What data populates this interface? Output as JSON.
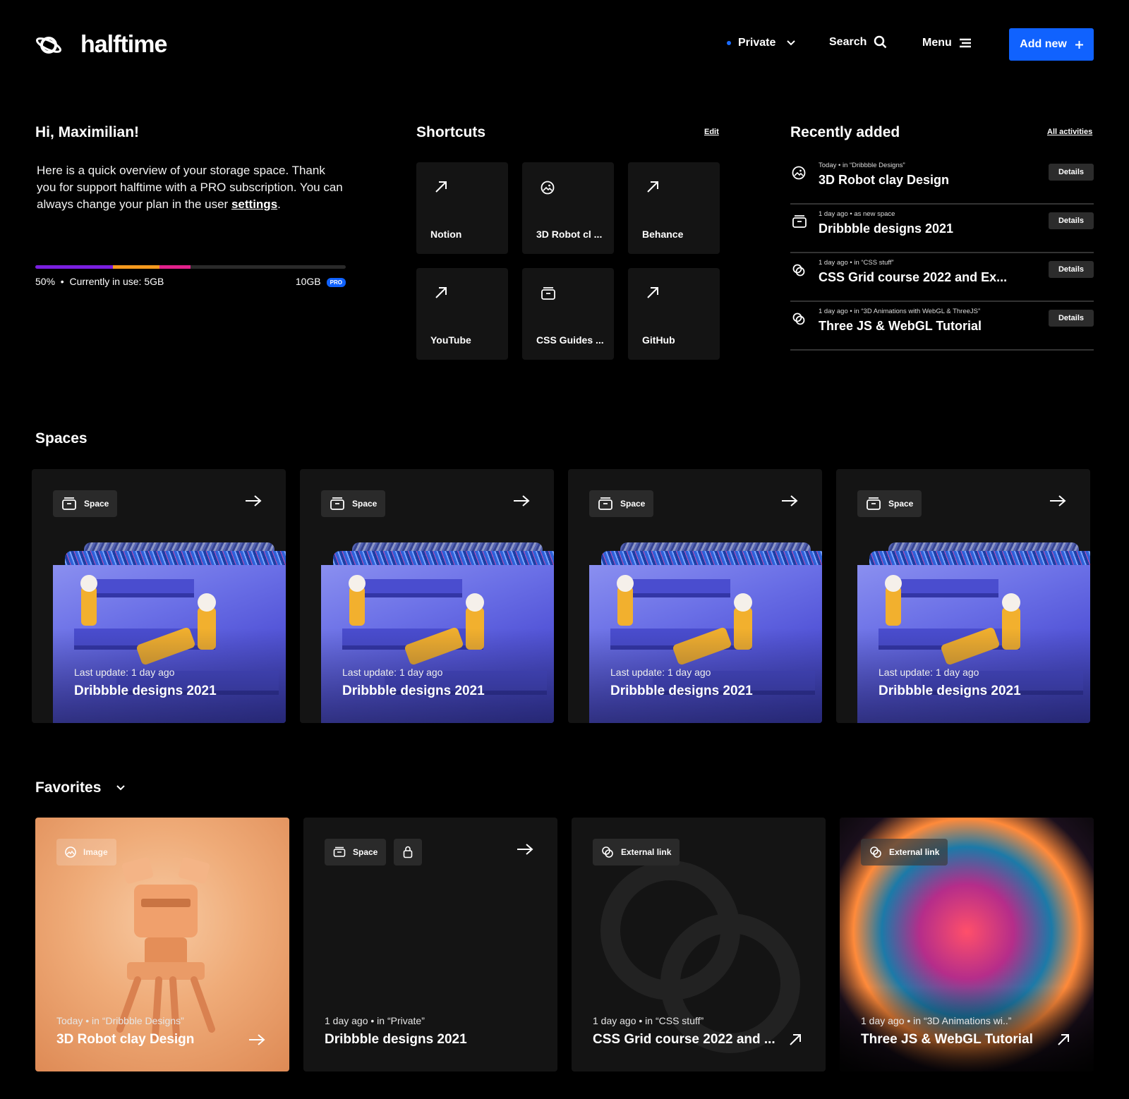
{
  "header": {
    "brand": "halftime",
    "private_label": "Private",
    "search_label": "Search",
    "menu_label": "Menu",
    "add_label": "Add new",
    "accent": "#1062fe"
  },
  "overview": {
    "greeting": "Hi, Maximilian!",
    "text": "Here is a quick overview of your storage space. Thank you for support halftime with a PRO subscription. You can always change your plan in the user",
    "settings_link": "settings",
    "text_end": ".",
    "usage_percent": 50,
    "usage_percent_label": "50%",
    "usage_text": "Currently in use: 5GB",
    "capacity": "10GB",
    "plan_badge": "PRO",
    "bar_segments": [
      {
        "color": "#7a1fe0",
        "fraction": 0.25
      },
      {
        "color": "#f59a1e",
        "fraction": 0.15
      },
      {
        "color": "#e2218b",
        "fraction": 0.1
      }
    ]
  },
  "shortcuts": {
    "title": "Shortcuts",
    "edit_label": "Edit",
    "items": [
      {
        "label": "Notion",
        "icon": "arrow-up-right-icon"
      },
      {
        "label": "3D Robot cl ...",
        "icon": "image-icon"
      },
      {
        "label": "Behance",
        "icon": "arrow-up-right-icon"
      },
      {
        "label": "YouTube",
        "icon": "arrow-up-right-icon"
      },
      {
        "label": "CSS Guides ...",
        "icon": "archive-icon"
      },
      {
        "label": "GitHub",
        "icon": "arrow-up-right-icon"
      }
    ]
  },
  "recent": {
    "title": "Recently added",
    "all_label": "All activities",
    "details_label": "Details",
    "items": [
      {
        "meta": "Today  •  in “Dribbble Designs”",
        "title": "3D Robot clay Design",
        "icon": "image-icon"
      },
      {
        "meta": "1 day ago •  as new space",
        "title": "Dribbble designs 2021",
        "icon": "archive-icon"
      },
      {
        "meta": "1 day ago  •  in “CSS stuff”",
        "title": "CSS Grid course 2022 and Ex...",
        "icon": "link-icon"
      },
      {
        "meta": "1 day ago  •  in “3D Animations with WebGL & ThreeJS”",
        "title": "Three JS & WebGL Tutorial",
        "icon": "link-icon"
      }
    ]
  },
  "spaces": {
    "title": "Spaces",
    "items": [
      {
        "chip": "Space",
        "update": "Last update: 1 day ago",
        "title": "Dribbble designs 2021"
      },
      {
        "chip": "Space",
        "update": "Last update: 1 day ago",
        "title": "Dribbble designs 2021"
      },
      {
        "chip": "Space",
        "update": "Last update: 1 day ago",
        "title": "Dribbble designs 2021"
      },
      {
        "chip": "Space",
        "update": "Last update: 1 day ago",
        "title": "Dribbble designs 2021"
      }
    ]
  },
  "favorites": {
    "title": "Favorites",
    "items": [
      {
        "chip": "Image",
        "meta": "Today  •  in “Dribbble Designs”",
        "title": "3D Robot clay Design"
      },
      {
        "chip": "Space",
        "meta": "1 day ago  •  in “Private”",
        "title": "Dribbble designs 2021"
      },
      {
        "chip": "External link",
        "meta": "1 day ago  •  in “CSS stuff”",
        "title": "CSS Grid course 2022 and ..."
      },
      {
        "chip": "External link",
        "meta": "1 day ago  •  in “3D Animations wi..”",
        "title": "Three JS & WebGL Tutorial"
      }
    ]
  }
}
